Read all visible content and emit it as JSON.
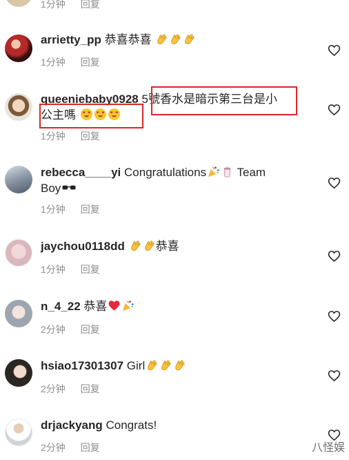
{
  "comments": [
    {
      "username": "",
      "text": "",
      "time": "1分钟",
      "reply": "回复"
    },
    {
      "username": "arrietty_pp",
      "text": "恭喜恭喜",
      "emojis": [
        "clap",
        "clap",
        "clap"
      ],
      "time": "1分钟",
      "reply": "回复"
    },
    {
      "username": "queeniebaby0928",
      "text": "5號香水是暗示第三台是小",
      "text2": "公主嗎",
      "emojis": [
        "heart-eyes",
        "heart-eyes",
        "heart-eyes"
      ],
      "time": "1分钟",
      "reply": "回复"
    },
    {
      "username": "rebecca____yi",
      "text": "Congratulations",
      "emojis": [
        "party-popper",
        "baby-bottle"
      ],
      "text_after": "Team",
      "text2": "Boy",
      "emojis2": [
        "sunglasses"
      ],
      "time": "1分钟",
      "reply": "回复"
    },
    {
      "username": "jaychou0118dd",
      "text": "恭喜",
      "emojis": [
        "clap",
        "clap"
      ],
      "time": "1分钟",
      "reply": "回复"
    },
    {
      "username": "n_4_22",
      "text": "恭喜",
      "emojis": [
        "red-heart",
        "party-popper"
      ],
      "time": "2分钟",
      "reply": "回复"
    },
    {
      "username": "hsiao17301307",
      "text": "Girl",
      "emojis": [
        "clap",
        "clap",
        "clap"
      ],
      "time": "2分钟",
      "reply": "回复"
    },
    {
      "username": "drjackyang",
      "text": "Congrats!",
      "time": "2分钟",
      "reply": "回复"
    }
  ],
  "watermark": "八怪娱",
  "colors": {
    "highlight_box": "#e02424",
    "meta_text": "#8e8e8e",
    "text": "#262626"
  }
}
